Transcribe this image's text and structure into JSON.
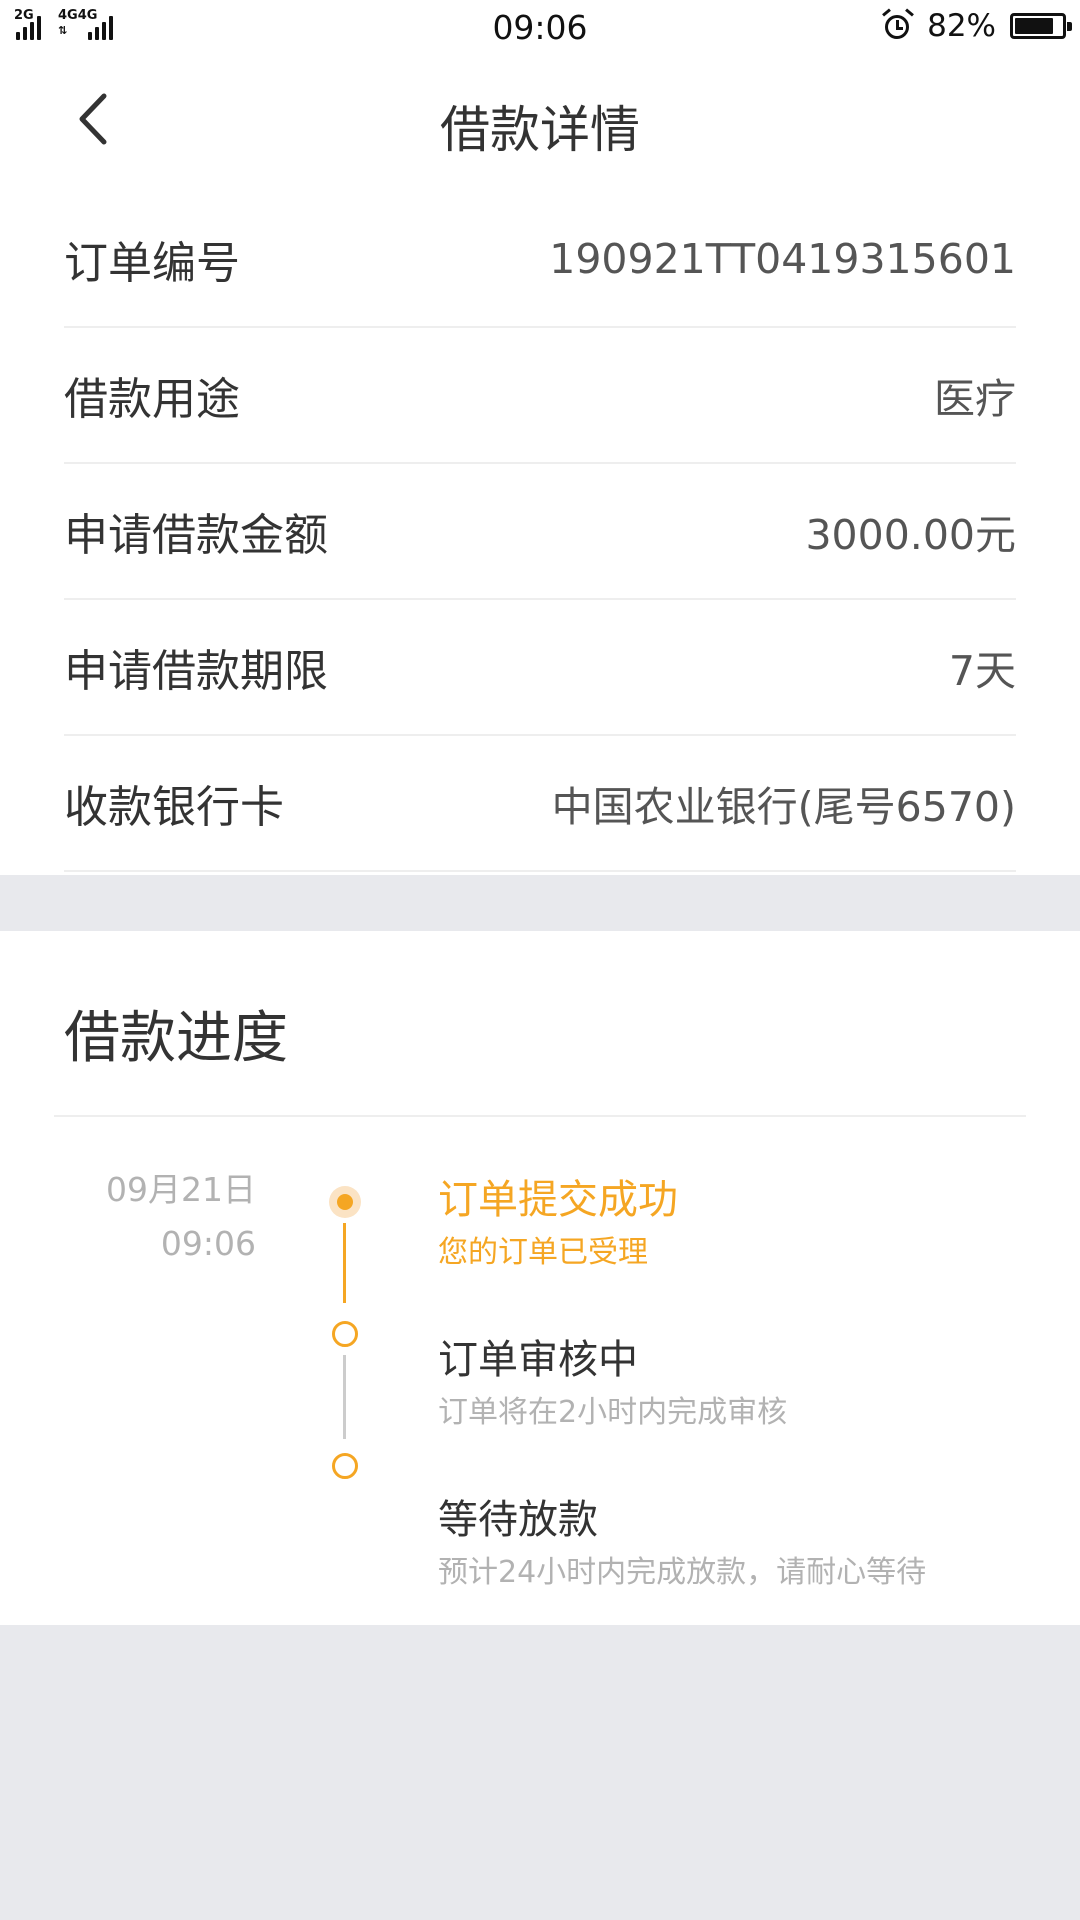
{
  "status_bar": {
    "net1": "2G",
    "net2a": "4G",
    "net2b": "4G",
    "time": "09:06",
    "battery_pct": "82%",
    "battery_level": 0.82
  },
  "header": {
    "title": "借款详情"
  },
  "details": [
    {
      "label": "订单编号",
      "value": "190921TT0419315601"
    },
    {
      "label": "借款用途",
      "value": "医疗"
    },
    {
      "label": "申请借款金额",
      "value": "3000.00元"
    },
    {
      "label": "申请借款期限",
      "value": "7天"
    },
    {
      "label": "收款银行卡",
      "value": "中国农业银行(尾号6570)"
    }
  ],
  "progress": {
    "title": "借款进度",
    "date": "09月21日",
    "time": "09:06",
    "steps": [
      {
        "title": "订单提交成功",
        "sub": "您的订单已受理",
        "state": "done"
      },
      {
        "title": "订单审核中",
        "sub": "订单将在2小时内完成审核",
        "state": "pending"
      },
      {
        "title": "等待放款",
        "sub": "预计24小时内完成放款，请耐心等待",
        "state": "pending"
      }
    ]
  },
  "colors": {
    "accent": "#f5a623",
    "accent_light": "#fbe3c4",
    "background_gray": "#e8e9ed",
    "line_gray": "#cccccc",
    "text_dark": "#333333",
    "text_light": "#b2b2b2"
  },
  "icons": {
    "back": "chevron-left-icon",
    "alarm": "alarm-clock-icon",
    "battery": "battery-icon",
    "signal": "signal-icon"
  }
}
